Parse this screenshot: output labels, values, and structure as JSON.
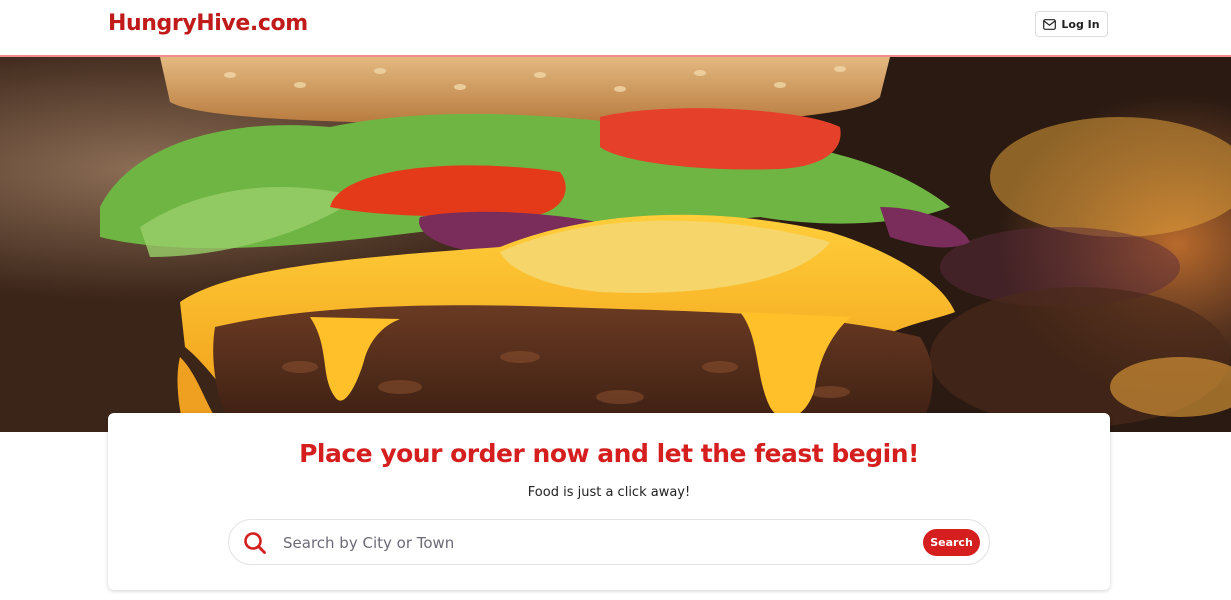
{
  "header": {
    "logo": "HungryHive.com",
    "login_label": "Log In",
    "login_icon": "envelope-icon"
  },
  "hero": {
    "image": "burger-photo"
  },
  "card": {
    "headline": "Place your order now and let the feast begin!",
    "subline": "Food is just a click away!",
    "search": {
      "placeholder": "Search by City or Town",
      "value": "",
      "button_label": "Search",
      "icon": "search-icon"
    }
  },
  "colors": {
    "brand": "#c01a1a",
    "accent": "#d51f1f",
    "header_border": "#f28b8b"
  }
}
